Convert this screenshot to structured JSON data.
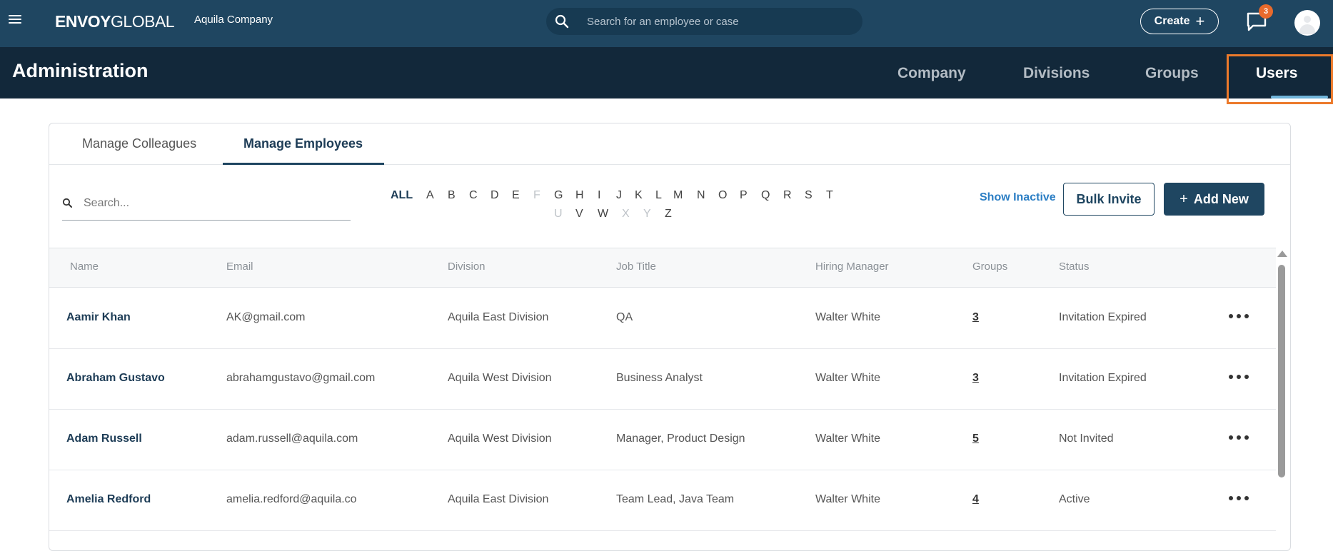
{
  "header": {
    "logo_bold": "ENVOY",
    "logo_light": "GLOBAL",
    "company": "Aquila Company",
    "search_placeholder": "Search for an employee or case",
    "create_label": "Create",
    "notifications_count": "3"
  },
  "admin": {
    "title": "Administration",
    "tabs": [
      {
        "label": "Company"
      },
      {
        "label": "Divisions"
      },
      {
        "label": "Groups"
      },
      {
        "label": "Users"
      }
    ],
    "active_tab": "Users"
  },
  "subtabs": [
    {
      "label": "Manage Colleagues"
    },
    {
      "label": "Manage Employees"
    }
  ],
  "filters": {
    "search_placeholder": "Search...",
    "alphabet": [
      "ALL",
      "A",
      "B",
      "C",
      "D",
      "E",
      "F",
      "G",
      "H",
      "I",
      "J",
      "K",
      "L",
      "M",
      "N",
      "O",
      "P",
      "Q",
      "R",
      "S",
      "T",
      "U",
      "V",
      "W",
      "X",
      "Y",
      "Z"
    ],
    "disabled_letters": [
      "F",
      "U",
      "X",
      "Y"
    ],
    "show_inactive": "Show Inactive",
    "bulk_invite": "Bulk Invite",
    "add_new": "Add New"
  },
  "table": {
    "columns": [
      "Name",
      "Email",
      "Division",
      "Job Title",
      "Hiring Manager",
      "Groups",
      "Status"
    ],
    "rows": [
      {
        "name": "Aamir Khan",
        "email": "AK@gmail.com",
        "division": "Aquila East Division",
        "job_title": "QA",
        "hiring_manager": "Walter White",
        "groups": "3",
        "status": "Invitation Expired"
      },
      {
        "name": "Abraham Gustavo",
        "email": "abrahamgustavo@gmail.com",
        "division": "Aquila West Division",
        "job_title": "Business Analyst",
        "hiring_manager": "Walter White",
        "groups": "3",
        "status": "Invitation Expired"
      },
      {
        "name": "Adam Russell",
        "email": "adam.russell@aquila.com",
        "division": "Aquila West Division",
        "job_title": "Manager, Product Design",
        "hiring_manager": "Walter White",
        "groups": "5",
        "status": "Not Invited"
      },
      {
        "name": "Amelia Redford",
        "email": "amelia.redford@aquila.co",
        "division": "Aquila East Division",
        "job_title": "Team Lead, Java Team",
        "hiring_manager": "Walter White",
        "groups": "4",
        "status": "Active"
      }
    ]
  },
  "colors": {
    "header_bg": "#1f4661",
    "admin_bg": "#12283a",
    "accent": "#1f4661",
    "highlight": "#ec7a2b",
    "link": "#2b7ec4",
    "badge": "#e86a2c"
  }
}
